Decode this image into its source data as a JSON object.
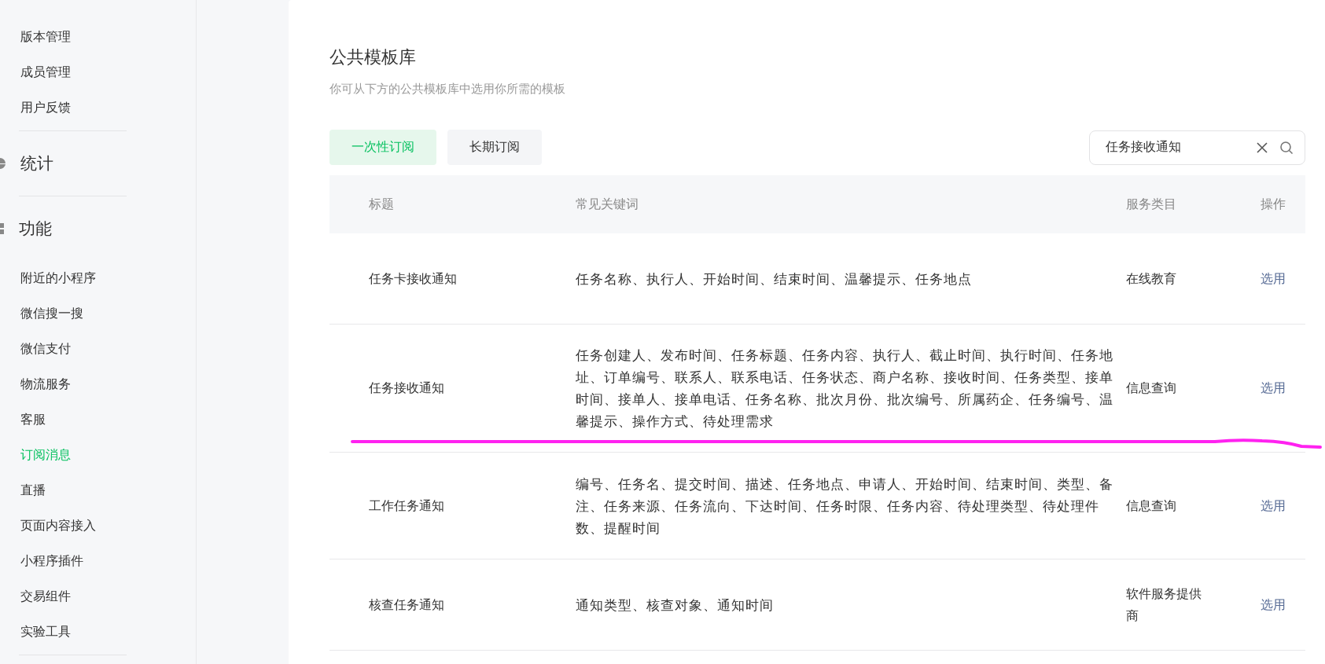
{
  "sidebar": {
    "groups": [
      {
        "items": [
          {
            "label": "版本管理",
            "selected": false
          },
          {
            "label": "成员管理",
            "selected": false
          },
          {
            "label": "用户反馈",
            "selected": false
          }
        ]
      },
      {
        "heading": "统计"
      },
      {
        "heading": "功能",
        "items": [
          {
            "label": "附近的小程序",
            "selected": false
          },
          {
            "label": "微信搜一搜",
            "selected": false
          },
          {
            "label": "微信支付",
            "selected": false
          },
          {
            "label": "物流服务",
            "selected": false
          },
          {
            "label": "客服",
            "selected": false
          },
          {
            "label": "订阅消息",
            "selected": true
          },
          {
            "label": "直播",
            "selected": false
          },
          {
            "label": "页面内容接入",
            "selected": false
          },
          {
            "label": "小程序插件",
            "selected": false
          },
          {
            "label": "交易组件",
            "selected": false
          },
          {
            "label": "实验工具",
            "selected": false
          }
        ]
      }
    ]
  },
  "page": {
    "title": "公共模板库",
    "subtitle": "你可从下方的公共模板库中选用你所需的模板"
  },
  "tabs": [
    {
      "label": "一次性订阅",
      "selected": true
    },
    {
      "label": "长期订阅",
      "selected": false
    }
  ],
  "search": {
    "value": "任务接收通知"
  },
  "table": {
    "columns": [
      "标题",
      "常见关键词",
      "服务类目",
      "操作"
    ],
    "rows": [
      {
        "title": "任务卡接收通知",
        "keywords": "任务名称、执行人、开始时间、结束时间、温馨提示、任务地点",
        "category": "在线教育",
        "action": "选用"
      },
      {
        "title": "任务接收通知",
        "keywords": "任务创建人、发布时间、任务标题、任务内容、执行人、截止时间、执行时间、任务地址、订单编号、联系人、联系电话、任务状态、商户名称、接收时间、任务类型、接单时间、接单人、接单电话、任务名称、批次月份、批次编号、所属药企、任务编号、温馨提示、操作方式、待处理需求",
        "category": "信息查询",
        "action": "选用"
      },
      {
        "title": "工作任务通知",
        "keywords": "编号、任务名、提交时间、描述、任务地点、申请人、开始时间、结束时间、类型、备注、任务来源、任务流向、下达时间、任务时限、任务内容、待处理类型、待处理件数、提醒时间",
        "category": "信息查询",
        "action": "选用"
      },
      {
        "title": "核查任务通知",
        "keywords": "通知类型、核查对象、通知时间",
        "category": "软件服务提供商",
        "action": "选用"
      }
    ]
  }
}
